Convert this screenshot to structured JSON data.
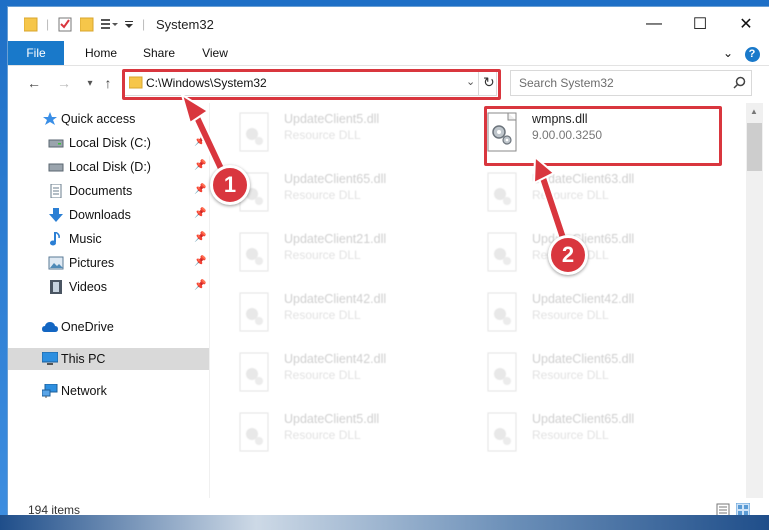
{
  "window": {
    "title": "System32",
    "controls": {
      "minimize": "—",
      "maximize": "☐",
      "close": "✕"
    }
  },
  "ribbon": {
    "tabs": [
      "File",
      "Home",
      "Share",
      "View"
    ],
    "help": "?"
  },
  "address_bar": {
    "path": "C:\\Windows\\System32",
    "search_placeholder": "Search System32"
  },
  "sidebar": {
    "items": [
      {
        "label": "Quick access",
        "icon": "star-icon",
        "pinned": false
      },
      {
        "label": "Local Disk (C:)",
        "icon": "drive-icon",
        "pinned": true
      },
      {
        "label": "Local Disk (D:)",
        "icon": "drive-icon",
        "pinned": true
      },
      {
        "label": "Documents",
        "icon": "documents-icon",
        "pinned": true
      },
      {
        "label": "Downloads",
        "icon": "download-arrow-icon",
        "pinned": true
      },
      {
        "label": "Music",
        "icon": "music-note-icon",
        "pinned": true
      },
      {
        "label": "Pictures",
        "icon": "pictures-icon",
        "pinned": true
      },
      {
        "label": "Videos",
        "icon": "video-film-icon",
        "pinned": true
      },
      {
        "label": "OneDrive",
        "icon": "cloud-icon",
        "pinned": false
      },
      {
        "label": "This PC",
        "icon": "monitor-icon",
        "pinned": false
      },
      {
        "label": "Network",
        "icon": "network-icon",
        "pinned": false
      }
    ]
  },
  "files": {
    "highlighted": {
      "name": "wmpns.dll",
      "version": "9.00.00.3250"
    },
    "left_column": [
      {
        "name": "UpdateClient5.dll",
        "desc": "Resource DLL"
      },
      {
        "name": "UpdateClient65.dll",
        "desc": "Resource DLL"
      },
      {
        "name": "UpdateClient21.dll",
        "desc": "Resource DLL"
      },
      {
        "name": "UpdateClient42.dll",
        "desc": "Resource DLL"
      },
      {
        "name": "UpdateClient42.dll",
        "desc": "Resource DLL"
      },
      {
        "name": "UpdateClient5.dll",
        "desc": "Resource DLL"
      }
    ],
    "right_column": [
      {
        "name": "UpdateClient63.dll",
        "desc": "Resource DLL"
      },
      {
        "name": "UpdateClient65.dll",
        "desc": "Resource DLL"
      },
      {
        "name": "UpdateClient42.dll",
        "desc": "Resource DLL"
      },
      {
        "name": "UpdateClient65.dll",
        "desc": "Resource DLL"
      },
      {
        "name": "UpdateClient65.dll",
        "desc": "Resource DLL"
      }
    ]
  },
  "status": {
    "item_count": "194 items"
  },
  "annotations": {
    "step1": "1",
    "step2": "2"
  },
  "colors": {
    "annotation_red": "#d9363e",
    "file_tab_blue": "#1979ca",
    "folder_yellow": "#f6c64a"
  }
}
